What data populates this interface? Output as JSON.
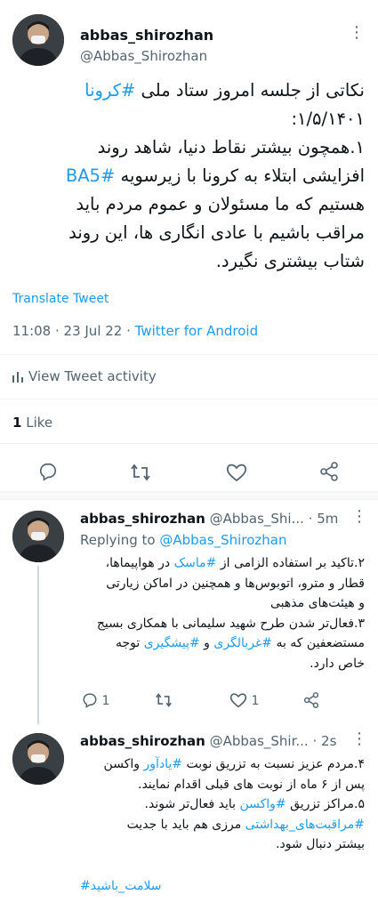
{
  "main_tweet": {
    "display_name": "abbas_shirozhan",
    "handle": "@Abbas_Shirozhan",
    "lines": [
      {
        "pre": "نکاتی از جلسه امروز ستاد ملی ",
        "tag": "#کرونا",
        "post": ""
      },
      {
        "pre": "۱/۵/۱۴۰۱:",
        "tag": "",
        "post": ""
      },
      {
        "pre": "۱.همچون بیشتر نقاط دنیا، شاهد روند",
        "tag": "",
        "post": ""
      },
      {
        "pre": "افزایشی ابتلاء به کرونا با زیرسویه ",
        "tag": "#BA5",
        "post": ""
      },
      {
        "pre": "هستیم که ما مسئولان و عموم مردم باید",
        "tag": "",
        "post": ""
      },
      {
        "pre": "مراقب باشیم با عادی انگاری ها، این روند",
        "tag": "",
        "post": ""
      },
      {
        "pre": "شتاب بیشتری نگیرد.",
        "tag": "",
        "post": ""
      }
    ],
    "translate_label": "Translate Tweet",
    "timestamp": "11:08 · 23 Jul 22 · ",
    "source": "Twitter for Android",
    "activity_label": "View Tweet activity",
    "likes_count": "1",
    "likes_label": " Like"
  },
  "replies": [
    {
      "display_name": "abbas_shirozhan",
      "handle": "@Abbas_Shi...",
      "age": "· 5m",
      "replying_prefix": "Replying to ",
      "replying_to": "@Abbas_Shirozhan",
      "lines": [
        {
          "pre": "۲.تاکید بر استفاده الزامی از ",
          "tag": "#ماسک",
          "post": " در هواپیماها،"
        },
        {
          "pre": "قطار و مترو، اتوبوس‌ها و همچنین در اماکن زیارتی",
          "tag": "",
          "post": ""
        },
        {
          "pre": "و هیئت‌های مذهبی",
          "tag": "",
          "post": ""
        },
        {
          "pre": "۳.فعال‌تر شدن طرح شهید سلیمانی با همکاری بسیج",
          "tag": "",
          "post": ""
        },
        {
          "pre": "مستضعفین که به ",
          "tag": "#غربالگری",
          "post": " و ",
          "tag2": "#پیشگیری",
          "post2": " توجه"
        },
        {
          "pre": "خاص دارد.",
          "tag": "",
          "post": ""
        }
      ],
      "reply_count": "1",
      "like_count": "1"
    },
    {
      "display_name": "abbas_shirozhan",
      "handle": "@Abbas_Shir...",
      "age": "· 2s",
      "lines": [
        {
          "pre": "۴.مردم عزیز نسبت به تزریق نوبت ",
          "tag": "#یادآور",
          "post": " واکسن"
        },
        {
          "pre": "پس از ۶ ماه از نوبت های قبلی اقدام نمایند.",
          "tag": "",
          "post": ""
        },
        {
          "pre": "۵.مراکز تزریق ",
          "tag": "#واکسن",
          "post": " باید فعال‌تر شوند."
        },
        {
          "pre": "",
          "tag": "#مراقبت‌های_بهداشتی",
          "post": " مرزی هم باید با جدیت"
        },
        {
          "pre": "بیشتر دنبال شود.",
          "tag": "",
          "post": ""
        }
      ],
      "closing_tag": "#سلامت_باشید"
    }
  ],
  "icons": [
    "more-icon",
    "reply-icon",
    "retweet-icon",
    "like-icon",
    "share-icon",
    "activity-icon"
  ],
  "colors": {
    "accent": "#1d9bf0",
    "secondary_text": "#536471",
    "divider": "#eff3f4"
  }
}
